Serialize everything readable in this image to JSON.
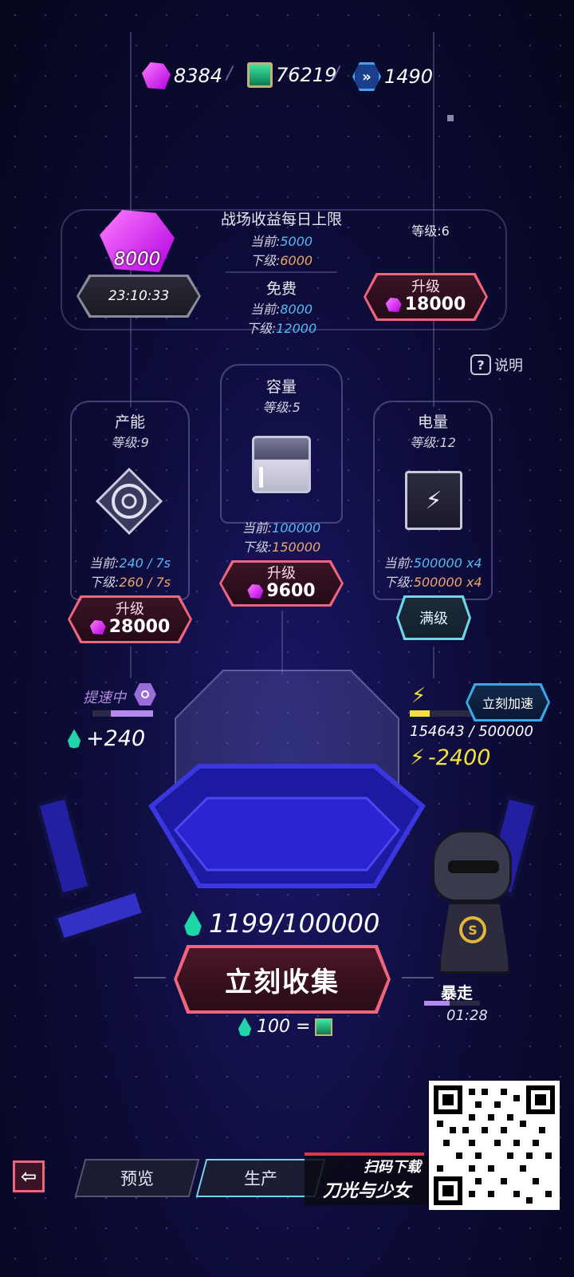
{
  "currencies": {
    "gems": "8384",
    "scroll": "76219",
    "token": "1490"
  },
  "battlefield": {
    "gem_amount": "8000",
    "timer": "23:10:33",
    "title": "战场收益每日上限",
    "current_label": "当前:",
    "current_value": "5000",
    "next_label": "下级:",
    "next_value": "6000",
    "free_label": "免费",
    "free_current_label": "当前:",
    "free_current_value": "8000",
    "free_next_label": "下级:",
    "free_next_value": "12000",
    "level_text": "等级:6",
    "upgrade_label": "升级",
    "upgrade_cost": "18000"
  },
  "help": {
    "label": "说明"
  },
  "production": {
    "title": "产能",
    "level_text": "等级:9",
    "current_label": "当前:",
    "current_value": "240 / 7s",
    "next_label": "下级:",
    "next_value": "260 / 7s",
    "upgrade_label": "升级",
    "upgrade_cost": "28000",
    "boost_label": "提速中",
    "gain": "+240"
  },
  "capacity": {
    "title": "容量",
    "level_text": "等级:5",
    "current_label": "当前:",
    "current_value": "100000",
    "next_label": "下级:",
    "next_value": "150000",
    "upgrade_label": "升级",
    "upgrade_cost": "9600"
  },
  "power": {
    "title": "电量",
    "level_text": "等级:12",
    "current_label": "当前:",
    "current_value": "500000 x4",
    "next_label": "下级:",
    "next_value": "500000 x4",
    "max_label": "满级",
    "speed_up_label": "立刻加速",
    "energy_text": "154643 / 500000",
    "energy_fraction": 0.31,
    "drain": "-2400"
  },
  "collect": {
    "stored": "1199/100000",
    "button_label": "立刻收集",
    "rate_text": "100 ="
  },
  "character": {
    "status": "暴走",
    "timer": "01:28"
  },
  "nav": {
    "preview": "预览",
    "produce": "生产"
  },
  "promo": {
    "line1": "扫码下载",
    "line2": "刀光与少女"
  },
  "colors": {
    "accent_pink": "#f0657c",
    "gem_purple": "#d12cf0",
    "current_blue": "#57b8f5",
    "next_orange": "#f2a468",
    "energy_yellow": "#f4e13c",
    "drop_green": "#1fd6a8"
  }
}
